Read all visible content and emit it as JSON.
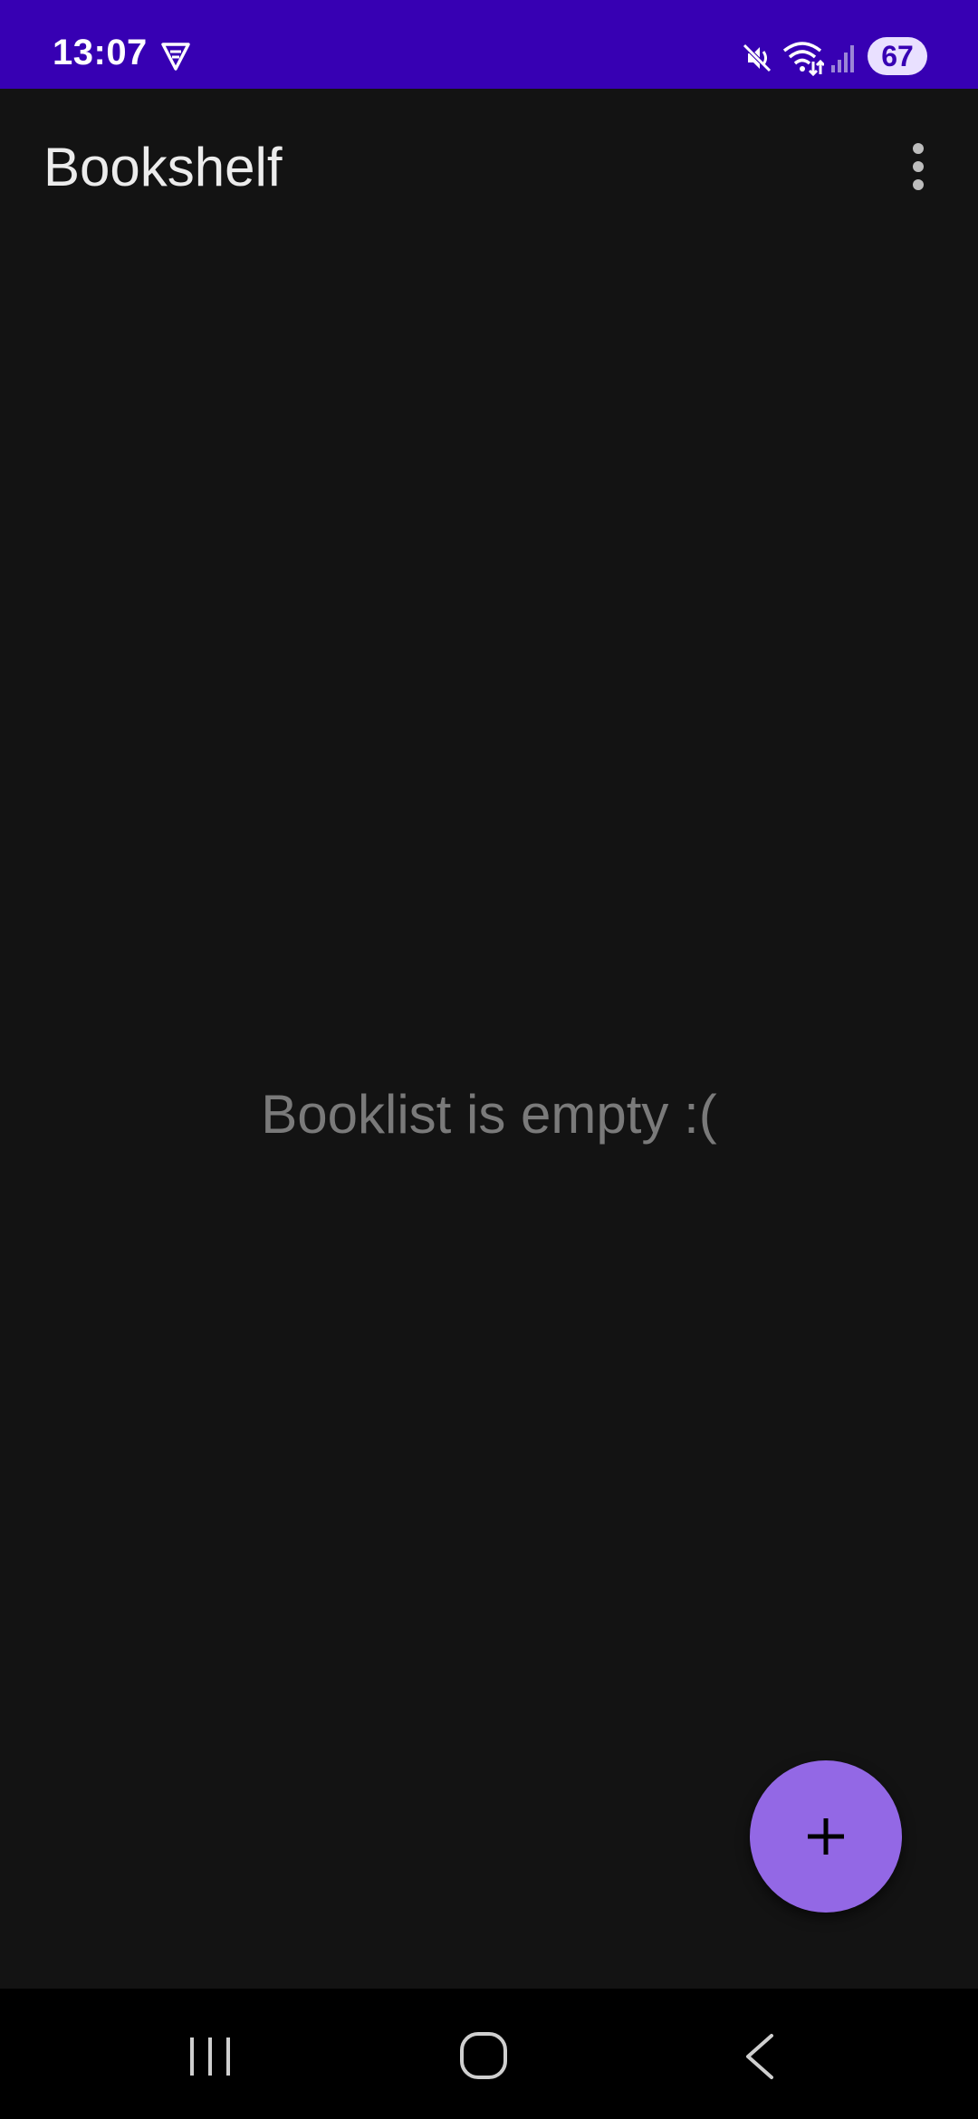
{
  "status_bar": {
    "time": "13:07",
    "battery": "67",
    "icons": [
      "vpn-icon",
      "mute-icon",
      "wifi-icon",
      "signal-icon"
    ]
  },
  "app_bar": {
    "title": "Bookshelf",
    "overflow_icon": "more-vert-icon"
  },
  "main": {
    "empty_message": "Booklist is empty :("
  },
  "fab": {
    "icon": "plus-icon",
    "color": "#9368e5"
  },
  "nav_bar": {
    "icons": [
      "recents-icon",
      "home-icon",
      "back-icon"
    ]
  },
  "colors": {
    "status_bar": "#3700b3",
    "background": "#131313",
    "nav_bar": "#000000"
  }
}
